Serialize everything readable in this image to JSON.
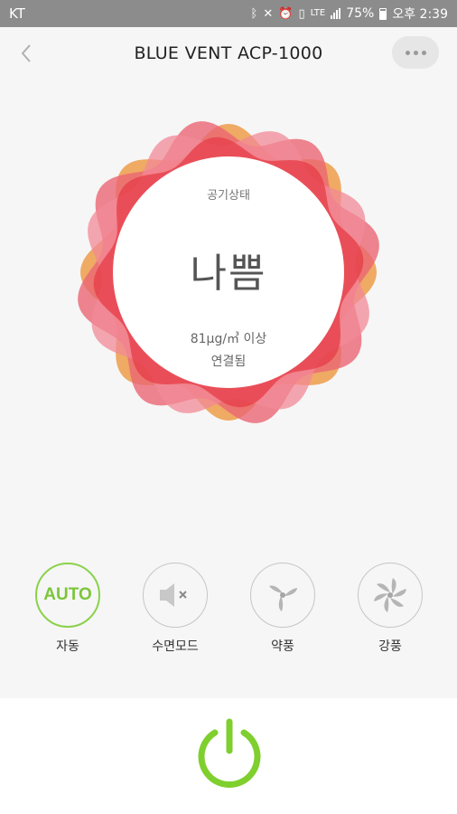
{
  "status_bar": {
    "carrier": "KT",
    "battery": "75%",
    "time": "오후 2:39",
    "icons": [
      "bluetooth-icon",
      "mute-icon",
      "alarm-icon",
      "vibrate-icon",
      "lte-icon",
      "signal-icon",
      "battery-icon"
    ],
    "network": "LTE"
  },
  "header": {
    "title": "BLUE VENT ACP-1000"
  },
  "air_status": {
    "label": "공기상태",
    "level": "나쁨",
    "range": "81μg/㎥ 이상",
    "connection": "연결됨",
    "colors": [
      "#f7a24d",
      "#f46a78",
      "#f0434d",
      "#fb8f9e"
    ]
  },
  "modes": [
    {
      "id": "auto",
      "icon_text": "AUTO",
      "label": "자동",
      "active": true
    },
    {
      "id": "sleep",
      "icon": "speaker-mute-icon",
      "label": "수면모드",
      "active": false
    },
    {
      "id": "weak",
      "icon": "fan-weak-icon",
      "label": "약풍",
      "active": false
    },
    {
      "id": "strong",
      "icon": "fan-strong-icon",
      "label": "강풍",
      "active": false
    }
  ],
  "colors": {
    "accent": "#7cc53a",
    "power": "#7fcf2e"
  }
}
